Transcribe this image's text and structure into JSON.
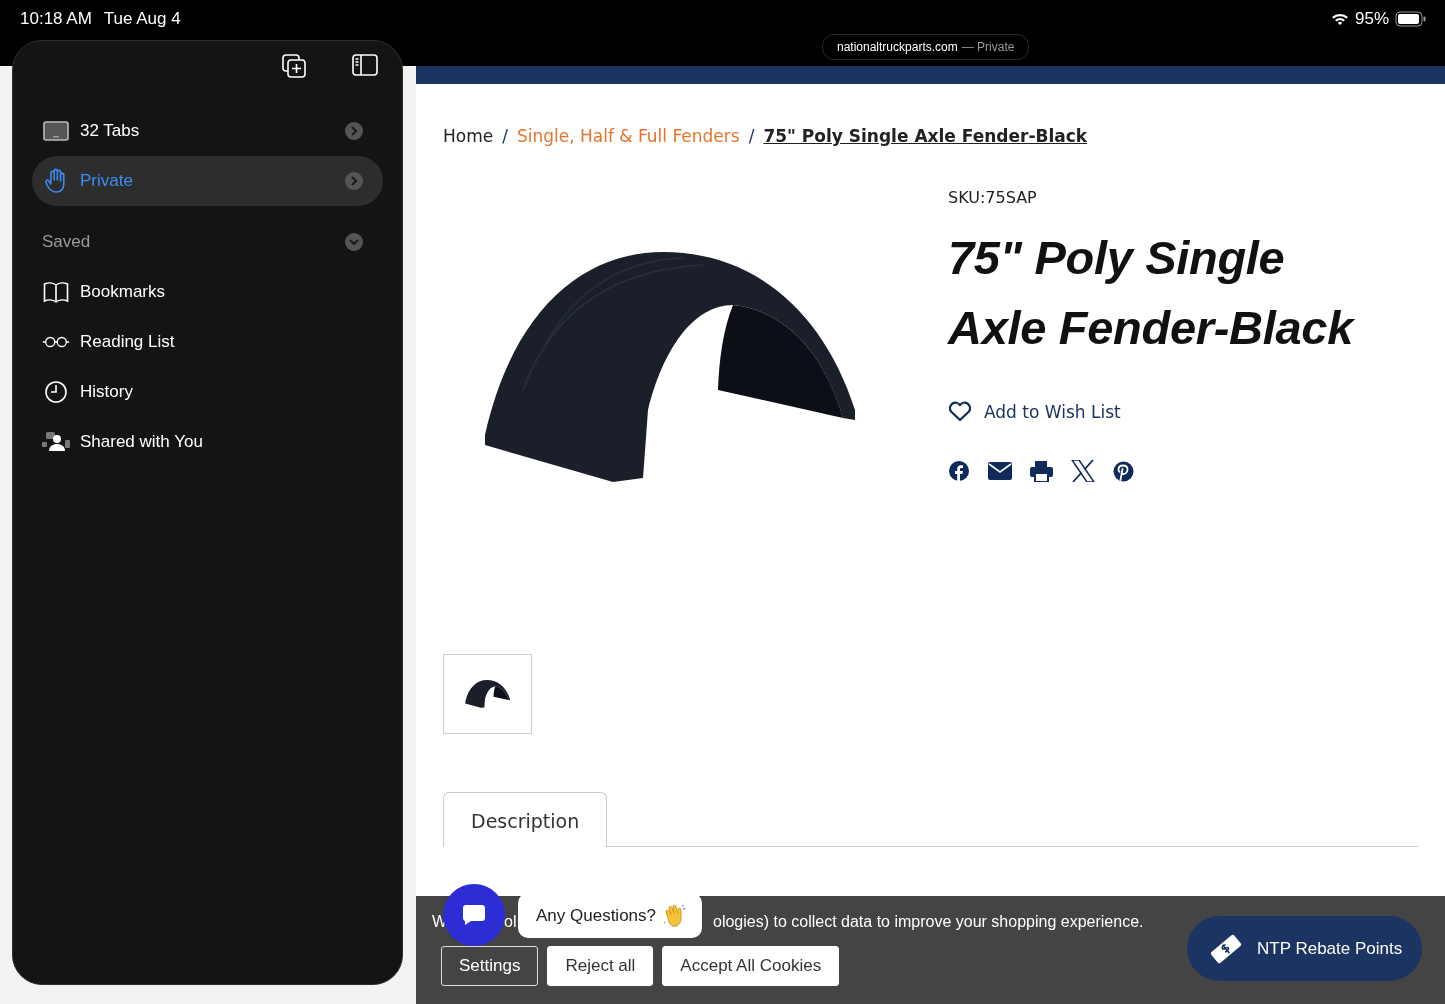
{
  "status_bar": {
    "time": "10:18 AM",
    "date": "Tue Aug 4",
    "battery": "95%"
  },
  "address_bar": {
    "domain": "nationaltruckparts.com",
    "mode": "— Private"
  },
  "sidebar": {
    "items": [
      {
        "kind": "tabs",
        "label": "32 Tabs",
        "selected": false
      },
      {
        "kind": "private",
        "label": "Private",
        "selected": true
      }
    ],
    "section": {
      "label": "Saved",
      "expanded": true
    },
    "saved_items": [
      {
        "kind": "bookmarks",
        "label": "Bookmarks"
      },
      {
        "kind": "reading",
        "label": "Reading List"
      },
      {
        "kind": "history",
        "label": "History"
      },
      {
        "kind": "shared",
        "label": "Shared with You"
      }
    ]
  },
  "breadcrumb_separator": "/",
  "breadcrumb": [
    {
      "kind": "plain",
      "label": "Home"
    },
    {
      "kind": "link",
      "label": "Single, Half & Full Fenders"
    },
    {
      "kind": "current",
      "label": "75\" Poly Single Axle Fender-Black"
    }
  ],
  "product": {
    "sku": "SKU:75SAP",
    "title_lines": [
      "75\" Poly Single",
      "Axle Fender-Black"
    ],
    "wishlist": "Add to Wish List"
  },
  "tabs": [
    {
      "label": "Description",
      "selected": true
    }
  ],
  "cookie_banner": {
    "text_fragments": [
      "W",
      "ol",
      "ologies) to collect data to improve your shopping experience."
    ],
    "buttons": [
      {
        "kind": "outline",
        "label": "Settings"
      },
      {
        "kind": "solid",
        "label": "Reject all"
      },
      {
        "kind": "solid",
        "label": "Accept All Cookies"
      }
    ]
  },
  "chat": {
    "bubble": "Any Questions?"
  },
  "rebate": {
    "label": "NTP Rebate Points"
  }
}
